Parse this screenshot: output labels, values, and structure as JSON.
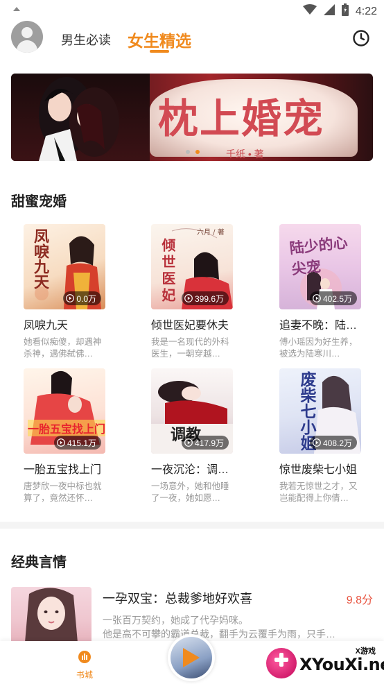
{
  "status_bar": {
    "time": "4:22",
    "left_icon": "notification-icon",
    "icons": [
      "wifi-icon",
      "signal-icon",
      "battery-icon"
    ]
  },
  "header": {
    "tabs": [
      {
        "label": "男生必读",
        "active": false
      },
      {
        "label": "女生精选",
        "active": true
      }
    ],
    "avatar_icon": "user-avatar-icon",
    "history_icon": "clock-icon",
    "accent_color": "#f08a1e"
  },
  "banner": {
    "title": "枕上婚宠",
    "author": "千纸 • 著",
    "dots": 2,
    "active_dot": 2
  },
  "sections": [
    {
      "title": "甜蜜宠婚",
      "books": [
        {
          "title": "凤唳九天",
          "plays": "0.0万",
          "desc": "她看似痴傻，却遇神杀神，遇佛弑佛…",
          "cover_text": "凤唳九天"
        },
        {
          "title": "倾世医妃要休夫",
          "plays": "399.6万",
          "desc": "我是一名现代的外科医生，一朝穿越…",
          "cover_text": "倾世医妃",
          "cover_author": "六月 / 著"
        },
        {
          "title": "追妻不晚：陆…",
          "plays": "402.5万",
          "desc": "傅小瑶因为好生养，被选为陆寒川…",
          "cover_text": "陆少的心尖宠"
        },
        {
          "title": "一胎五宝找上门",
          "plays": "415.1万",
          "desc": "唐梦欣一夜中标也就算了，竟然还怀…",
          "cover_text": "一胎五宝找上门"
        },
        {
          "title": "一夜沉沦：调…",
          "plays": "417.9万",
          "desc": "一场意外，她和他睡了一夜，她如愿…",
          "cover_text": "调教"
        },
        {
          "title": "惊世废柴七小姐",
          "plays": "408.2万",
          "desc": "我若无惊世之才，又岂能配得上你倩…",
          "cover_text": "废柴七小姐"
        }
      ]
    },
    {
      "title": "经典言情",
      "items": [
        {
          "title": "一孕双宝：总裁爹地好欢喜",
          "score": "9.8分",
          "desc_line1": "一张百万契约，她成了代孕妈咪。",
          "desc_line2": "他是高不可攀的霸道总裁，翻手为云覆手为雨，只手…"
        }
      ]
    }
  ],
  "bottom_nav": {
    "bookstore_label": "书城",
    "bookstore_icon": "bookstore-icon",
    "player_icon": "play-icon"
  },
  "watermark": {
    "sub": "X游戏",
    "main": "XYouXi.net"
  }
}
